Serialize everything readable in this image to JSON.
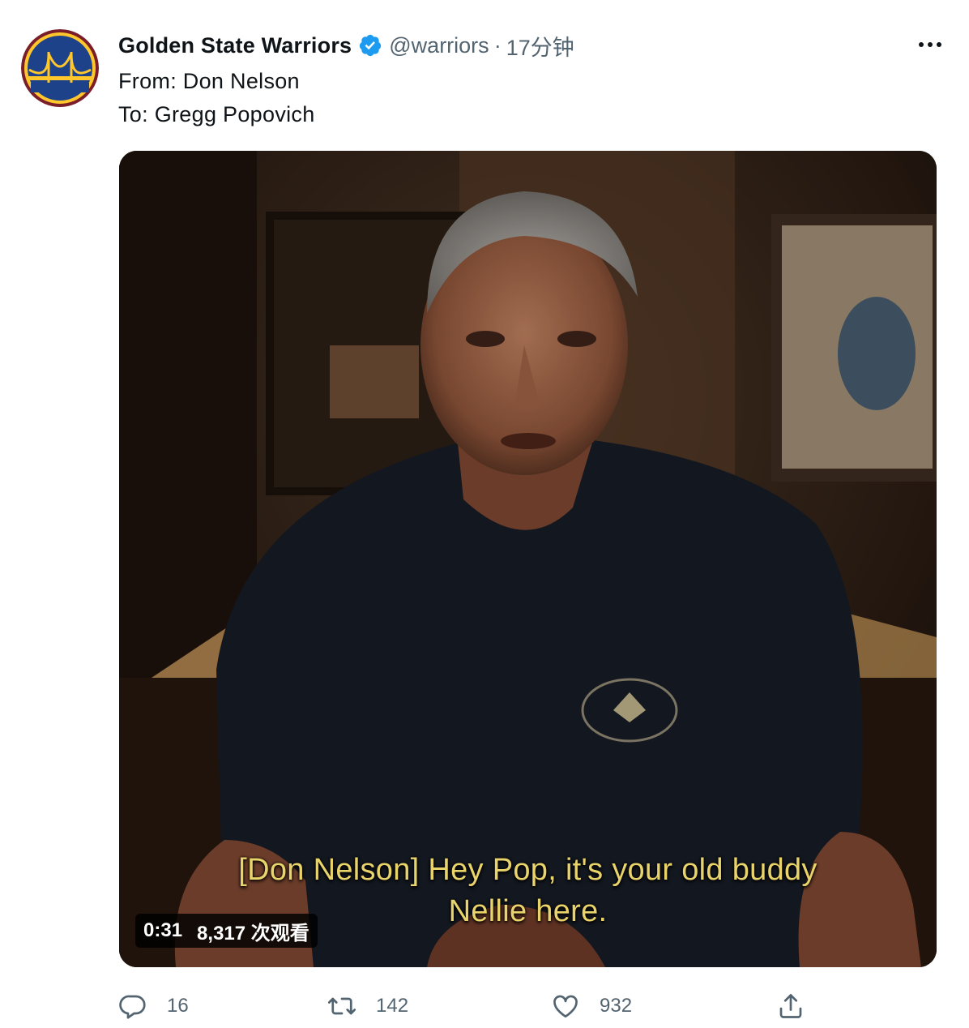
{
  "tweet": {
    "display_name": "Golden State Warriors",
    "handle": "@warriors",
    "separator": "·",
    "time": "17分钟",
    "more_label": "···",
    "text_lines": [
      "From: Don Nelson",
      "To: Gregg Popovich"
    ]
  },
  "video": {
    "subtitle_lines": [
      "[Don Nelson] Hey Pop, it's your old buddy",
      "Nellie here."
    ],
    "duration": "0:31",
    "views": "8,317 次观看"
  },
  "actions": {
    "reply_count": "16",
    "retweet_count": "142",
    "like_count": "932"
  },
  "icons": {
    "avatar": "warriors-logo-icon",
    "verified": "verified-badge-icon",
    "more": "more-icon",
    "reply": "reply-icon",
    "retweet": "retweet-icon",
    "like": "heart-icon",
    "share": "share-icon"
  },
  "colors": {
    "accent": "#1d9bf0",
    "muted": "#536471",
    "subtitle": "#e9d46b",
    "warriors_blue": "#1d428a",
    "warriors_gold": "#ffc72c"
  }
}
